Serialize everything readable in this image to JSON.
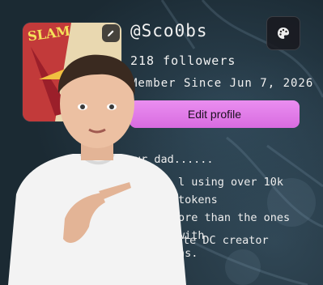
{
  "profile": {
    "username": "@Sco0bs",
    "followers": "218 followers",
    "member_since": "Member Since Jun 7, 2026",
    "edit_button": "Edit profile"
  },
  "bio": {
    "line1": "ur dad......",
    "line2": "l using over 10k tokens",
    "line3": "ore than the ones with",
    "line4": "ns.",
    "creator": "te DC creator"
  },
  "avatar": {
    "comic_text": "SLAM"
  },
  "icons": {
    "avatar_edit": "pencil-icon",
    "theme": "palette-icon"
  },
  "colors": {
    "accent": "#e07ae8",
    "background": "#1b2a33"
  }
}
